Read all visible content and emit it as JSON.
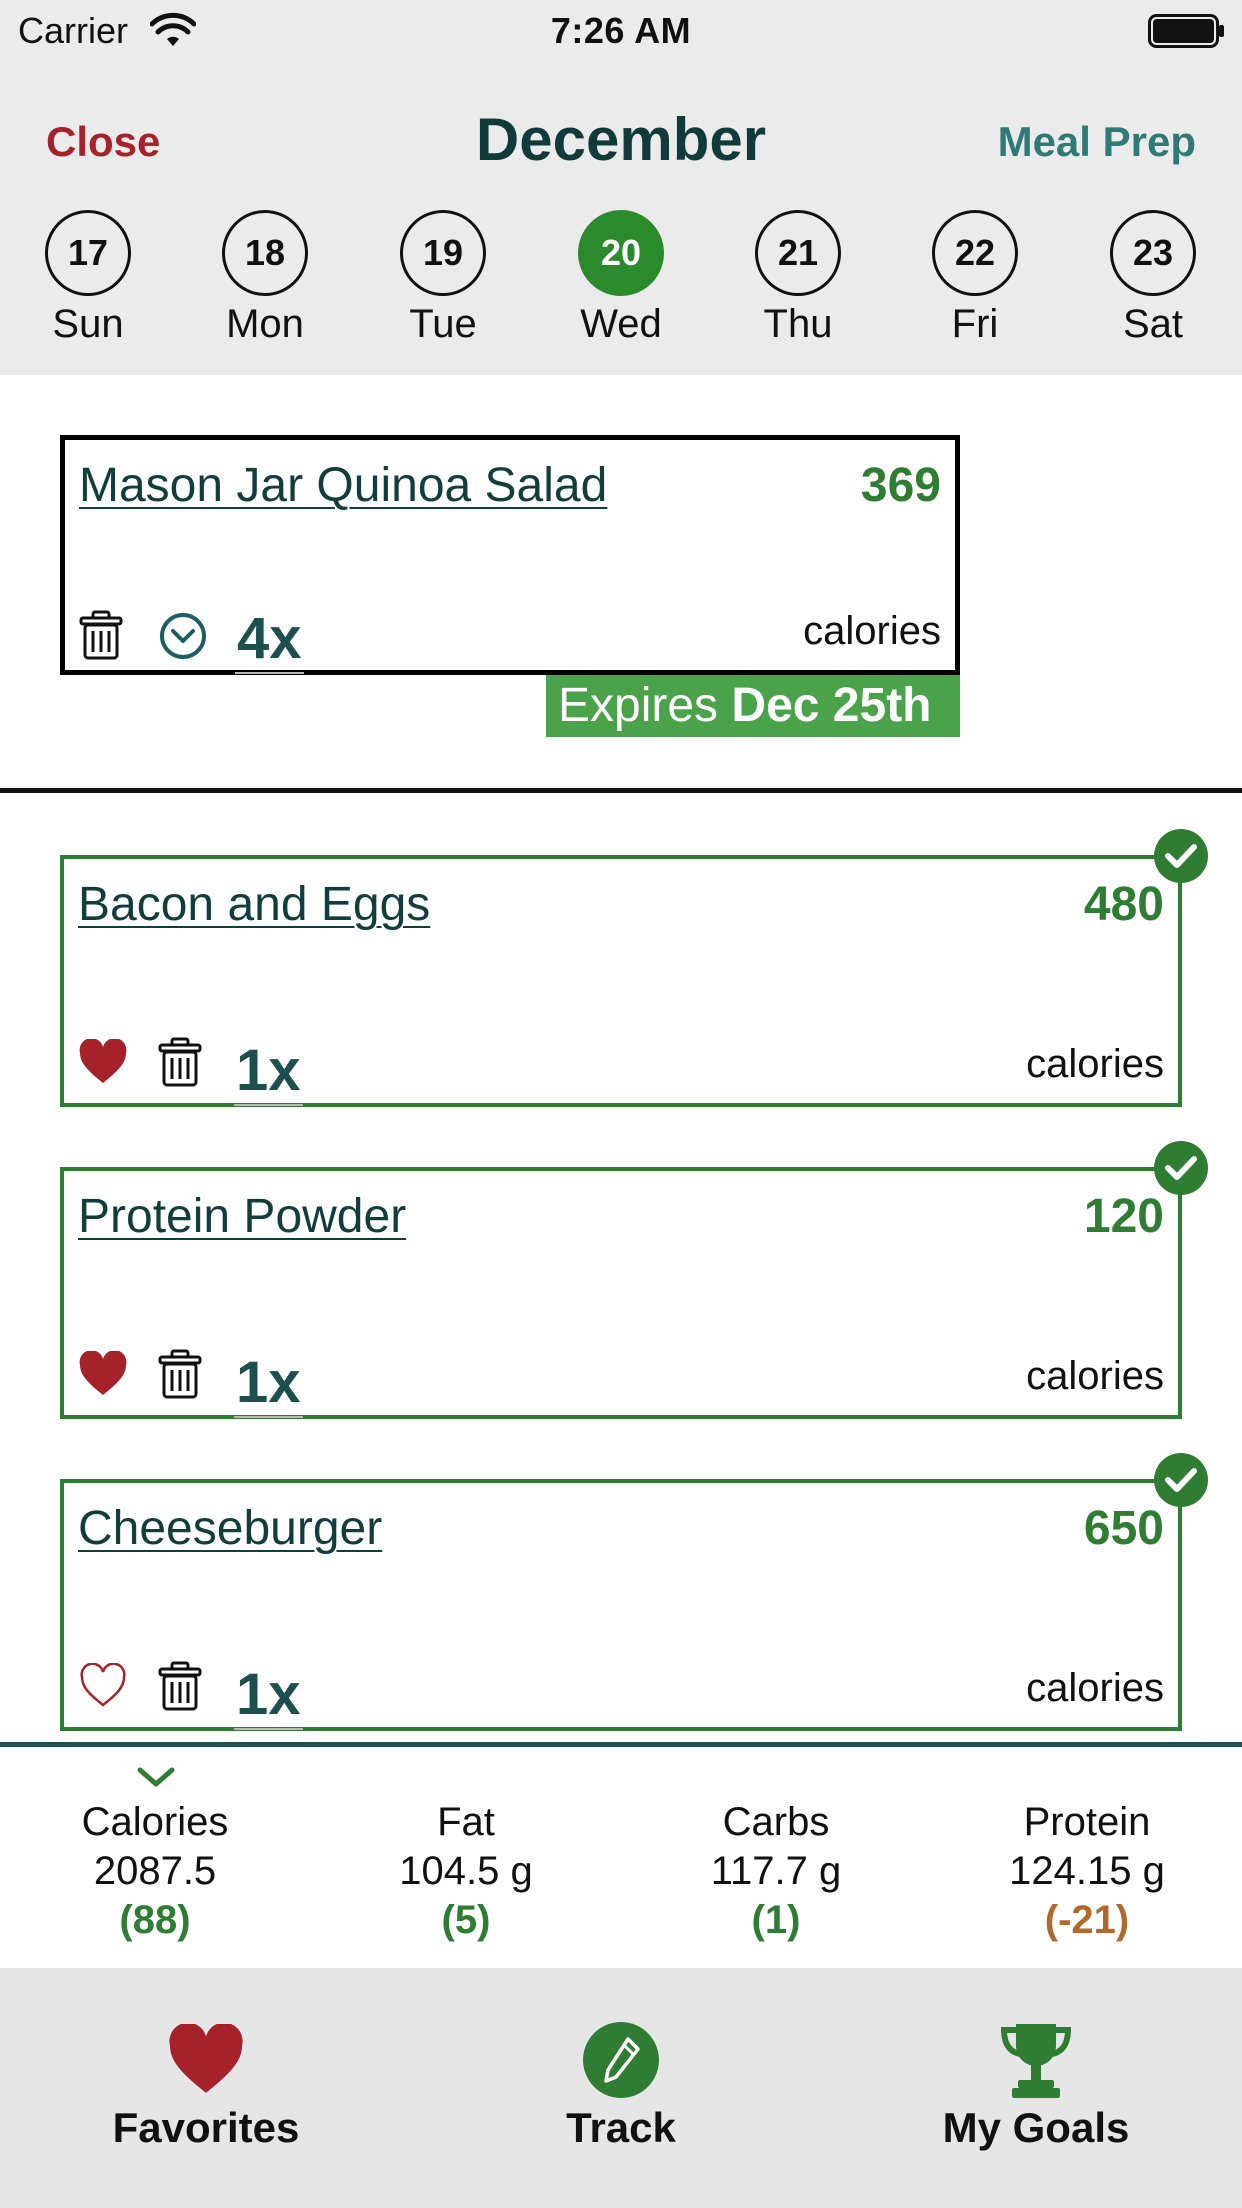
{
  "status": {
    "carrier": "Carrier",
    "time": "7:26 AM"
  },
  "header": {
    "close": "Close",
    "month": "December",
    "meal_prep": "Meal Prep"
  },
  "days": [
    {
      "num": "17",
      "name": "Sun"
    },
    {
      "num": "18",
      "name": "Mon"
    },
    {
      "num": "19",
      "name": "Tue"
    },
    {
      "num": "20",
      "name": "Wed",
      "selected": true
    },
    {
      "num": "21",
      "name": "Thu"
    },
    {
      "num": "22",
      "name": "Fri"
    },
    {
      "num": "23",
      "name": "Sat"
    }
  ],
  "prep_card": {
    "title": "Mason Jar Quinoa Salad",
    "calories": "369",
    "calories_label": "calories",
    "quantity": "4x",
    "expires_prefix": "Expires",
    "expires_date": "Dec 25th",
    "icons": [
      "trash-icon",
      "chevron-circle-down-icon"
    ]
  },
  "meals": [
    {
      "title": "Bacon and Eggs",
      "calories": "480",
      "calories_label": "calories",
      "quantity": "1x",
      "favorite": true
    },
    {
      "title": "Protein Powder",
      "calories": "120",
      "calories_label": "calories",
      "quantity": "1x",
      "favorite": true
    },
    {
      "title": "Cheeseburger",
      "calories": "650",
      "calories_label": "calories",
      "quantity": "1x",
      "favorite": false
    }
  ],
  "summary": {
    "calories": {
      "label": "Calories",
      "value": "2087.5",
      "diff": "(88)"
    },
    "fat": {
      "label": "Fat",
      "value": "104.5 g",
      "diff": "(5)"
    },
    "carbs": {
      "label": "Carbs",
      "value": "117.7 g",
      "diff": "(1)"
    },
    "protein": {
      "label": "Protein",
      "value": "124.15 g",
      "diff": "(-21)"
    }
  },
  "tabs": {
    "favorites": "Favorites",
    "track": "Track",
    "goals": "My Goals"
  },
  "colors": {
    "accent_green": "#2e7d32",
    "selected_day": "#2b8a2b",
    "close_red": "#a5222b",
    "meal_prep_teal": "#2f7a76",
    "negative_diff": "#b06a2e",
    "heart_red": "#a5222b"
  }
}
